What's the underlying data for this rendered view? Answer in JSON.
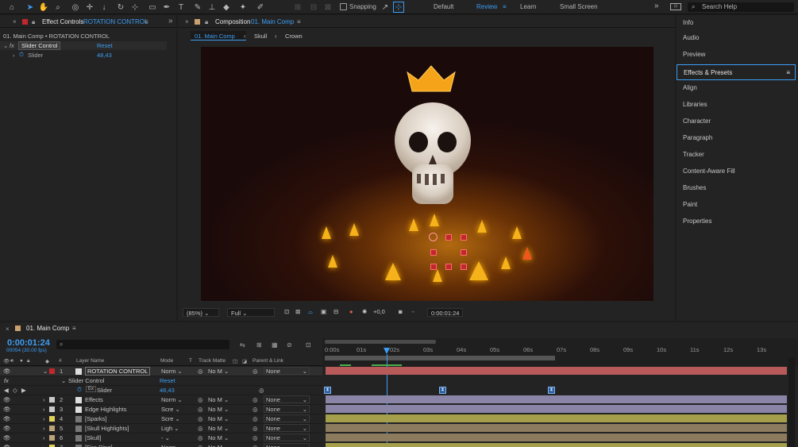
{
  "toolbar": {
    "snapping_label": "Snapping",
    "workspaces": [
      "Default",
      "Review",
      "Learn",
      "Small Screen"
    ],
    "active_workspace": "Review",
    "search_placeholder": "Search Help"
  },
  "effect_controls": {
    "tab_prefix": "Effect Controls",
    "tab_layer": "ROTATION CONTROL",
    "subtitle": "01. Main Comp • ROTATION CONTROL",
    "effect_name": "Slider Control",
    "reset_label": "Reset",
    "property_name": "Slider",
    "property_value": "48,43"
  },
  "composition": {
    "tab_prefix": "Composition",
    "tab_name": "01. Main Comp",
    "breadcrumbs": [
      "01. Main Comp",
      "Skull",
      "Crown"
    ],
    "zoom": "(85%)",
    "resolution": "Full",
    "exposure": "+0,0",
    "timecode": "0:00:01:24"
  },
  "right_panel": {
    "items": [
      "Info",
      "Audio",
      "Preview",
      "Effects & Presets",
      "Align",
      "Libraries",
      "Character",
      "Paragraph",
      "Tracker",
      "Content-Aware Fill",
      "Brushes",
      "Paint",
      "Properties"
    ],
    "selected": "Effects & Presets"
  },
  "timeline": {
    "tab_name": "01. Main Comp",
    "current_time": "0:00:01:24",
    "frame_info": "00054 (30.00 fps)",
    "columns": {
      "num": "#",
      "layer_name": "Layer Name",
      "mode": "Mode",
      "t": "T",
      "track_matte": "Track Matte",
      "parent": "Parent & Link"
    },
    "ruler": [
      "0:00s",
      "01s",
      "02s",
      "03s",
      "04s",
      "05s",
      "06s",
      "07s",
      "08s",
      "09s",
      "10s",
      "11s",
      "12s",
      "13s"
    ],
    "layers": [
      {
        "num": "1",
        "name": "ROTATION CONTROL",
        "mode": "Norm",
        "matte": "No M",
        "parent": "None",
        "color": "#c9c9c9"
      },
      {
        "num": "2",
        "name": "Effects",
        "mode": "Norm",
        "matte": "No M",
        "parent": "None",
        "color": "#c9c9c9"
      },
      {
        "num": "3",
        "name": "Edge Highlights",
        "mode": "Scre",
        "matte": "No M",
        "parent": "None",
        "color": "#c9c9c9"
      },
      {
        "num": "4",
        "name": "[Sparks]",
        "mode": "Scre",
        "matte": "No M",
        "parent": "None",
        "color": "#e0d15a"
      },
      {
        "num": "5",
        "name": "[Skull Highlights]",
        "mode": "Ligh",
        "matte": "No M",
        "parent": "None",
        "color": "#bca47a"
      },
      {
        "num": "6",
        "name": "[Skull]",
        "mode": "-",
        "matte": "No M",
        "parent": "None",
        "color": "#bca47a"
      },
      {
        "num": "7",
        "name": "[Fire Ring]",
        "mode": "Norm",
        "matte": "No M",
        "parent": "None",
        "color": "#e0d15a"
      }
    ],
    "sub_effect": "Slider Control",
    "sub_reset": "Reset",
    "sub_property": "Slider",
    "sub_value": "48,43"
  },
  "colors": {
    "accent": "#3d9df3",
    "layer1_bar": "#b85a5a",
    "purple_bar": "#8a84a6",
    "yellow_bar": "#a59f4c",
    "tan_bar": "#8c7b5d"
  }
}
